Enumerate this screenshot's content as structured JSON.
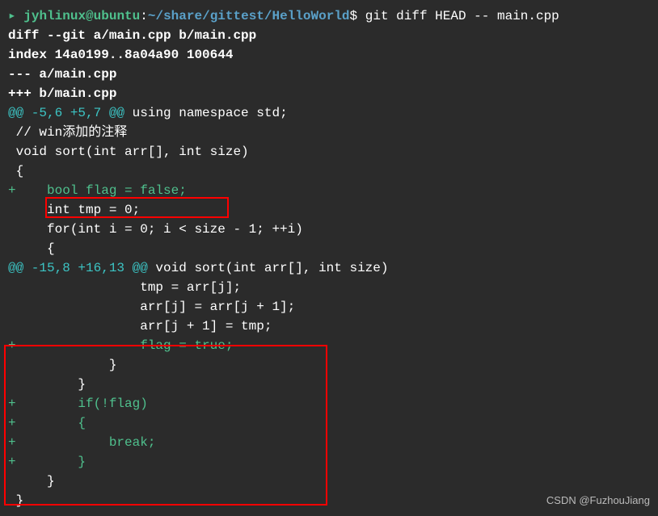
{
  "prompt": {
    "arrow": "▸ ",
    "user_host": "jyhlinux@ubuntu",
    "colon": ":",
    "path": "~/share/gittest/HelloWorld",
    "dollar": "$",
    "command": "git diff HEAD -- main.cpp"
  },
  "diff": {
    "header1": "diff --git a/main.cpp b/main.cpp",
    "header2": "index 14a0199..8a04a90 100644",
    "header3": "--- a/main.cpp",
    "header4": "+++ b/main.cpp",
    "hunk1_prefix": "@@ -5,6 +5,7 @@",
    "hunk1_suffix": " using namespace std;",
    "ctx1": " // win添加的注释",
    "ctx2": " void sort(int arr[], int size)",
    "ctx3": " {",
    "add1": "+    bool flag = false;",
    "ctx4": "     int tmp = 0;",
    "ctx5": "     for(int i = 0; i < size - 1; ++i)",
    "ctx6": "     {",
    "hunk2_prefix": "@@ -15,8 +16,13 @@",
    "hunk2_suffix": " void sort(int arr[], int size)",
    "ctx7": "                 tmp = arr[j];",
    "ctx8": "                 arr[j] = arr[j + 1];",
    "ctx9": "                 arr[j + 1] = tmp;",
    "add2": "+                flag = true;",
    "ctx10": "             }",
    "ctx11": "         }",
    "add3": "+        if(!flag)",
    "add4": "+        {",
    "add5": "+            break;",
    "add6": "+        }",
    "ctx12": "     }",
    "ctx13": " }"
  },
  "watermark": "CSDN @FuzhouJiang"
}
